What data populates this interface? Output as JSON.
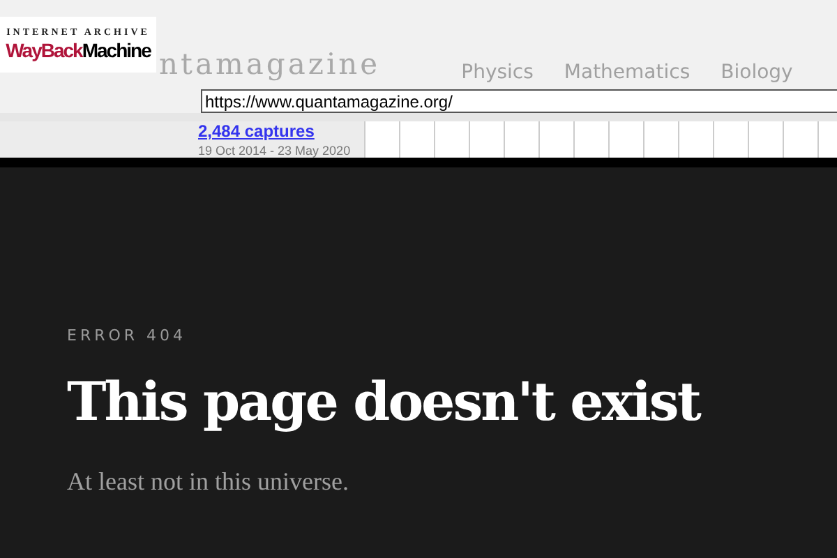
{
  "wayback": {
    "logo_top": "INTERNET ARCHIVE",
    "logo_red": "WayBack",
    "logo_black": "Machine",
    "url": "https://www.quantamagazine.org/",
    "captures": "2,484 captures",
    "date_range": "19 Oct 2014 - 23 May 2020"
  },
  "site_header": {
    "brand": "ntamagazine",
    "nav": [
      "Physics",
      "Mathematics",
      "Biology"
    ]
  },
  "error": {
    "code": "ERROR 404",
    "title": "This page doesn't exist",
    "message": "At least not in this universe."
  }
}
